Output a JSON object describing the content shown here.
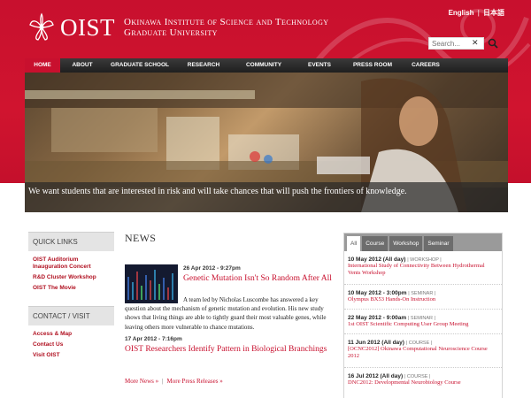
{
  "header": {
    "logo_text": "OIST",
    "institute_line1": "Okinawa Institute of Science and Technology",
    "institute_line2": "Graduate University",
    "lang_en": "English",
    "lang_sep": "|",
    "lang_ja": "日本語",
    "search_placeholder": "Search...",
    "search_clear": "✕",
    "brand_color": "#c8102e"
  },
  "nav": {
    "items": [
      "HOME",
      "ABOUT",
      "GRADUATE SCHOOL",
      "RESEARCH",
      "COMMUNITY",
      "EVENTS",
      "PRESS ROOM",
      "CAREERS"
    ],
    "active_index": 0
  },
  "hero": {
    "caption": "We want students that are interested in risk and will take chances that will push the frontiers of knowledge."
  },
  "quick_links": {
    "heading": "QUICK LINKS",
    "items": [
      "OIST Auditorium Inauguration Concert",
      "R&D Cluster Workshop",
      "OIST The Movie"
    ]
  },
  "contact": {
    "heading": "CONTACT / VISIT",
    "items": [
      "Access & Map",
      "Contact Us",
      "Visit OIST"
    ]
  },
  "news": {
    "heading": "NEWS",
    "items": [
      {
        "date": "26 Apr 2012 - 9:27pm",
        "title": "Genetic Mutation Isn't So Random After All",
        "body": "A team led by Nicholas Luscombe has answered a key question about the mechanism of genetic mutation and evolution. His new study shows that living things are able to tightly guard their most valuable genes, while leaving others more vulnerable to chance mutations."
      },
      {
        "date": "17 Apr 2012 - 7:16pm",
        "title": "OIST Researchers Identify Pattern in Biological Branchings"
      }
    ],
    "more_news": "More News »",
    "more_sep": "|",
    "more_press": "More Press Releases »"
  },
  "events": {
    "tabs": [
      "All",
      "Course",
      "Workshop",
      "Seminar"
    ],
    "active_tab": 0,
    "items": [
      {
        "date": "10 May 2012 (All day)",
        "type": "| WORKSHOP |",
        "title": "International Study of Connectivity Between Hydrothermal Vents Workshop"
      },
      {
        "date": "10 May 2012 - 3:00pm",
        "type": "| SEMINAR |",
        "title": "Olympus BX53 Hands-On Instruction"
      },
      {
        "date": "22 May 2012 - 9:00am",
        "type": "| SEMINAR |",
        "title": "1st OIST Scientific Computing User Group Meeting"
      },
      {
        "date": "11 Jun 2012 (All day)",
        "type": "| COURSE |",
        "title": "[OCNC2012] Okinawa Computational Neuroscience Course 2012"
      },
      {
        "date": "16 Jul 2012 (All day)",
        "type": "| COURSE |",
        "title": "DNC2012: Developmental Neurobiology Course"
      }
    ]
  }
}
